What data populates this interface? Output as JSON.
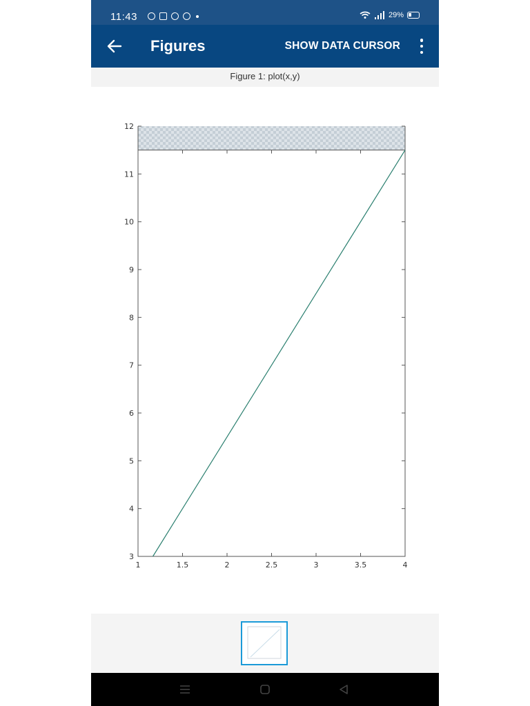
{
  "status_bar": {
    "time": "11:43",
    "battery_percent": "29%",
    "icons": [
      "messenger-icon",
      "calendar-icon",
      "message-icon",
      "facebook-icon",
      "wifi-icon",
      "signal-icon",
      "battery-icon"
    ]
  },
  "app_bar": {
    "title": "Figures",
    "data_cursor_label": "SHOW DATA CURSOR"
  },
  "figure": {
    "header": "Figure 1: plot(x,y)"
  },
  "colors": {
    "status_bar": "#1e5287",
    "app_bar": "#084781",
    "line": "#2a7f6f",
    "thumbnail_border": "#1a9ad8"
  },
  "chart_data": {
    "type": "line",
    "series": [
      {
        "x": [
          1.167,
          4.0
        ],
        "y": [
          3.0,
          11.5
        ]
      }
    ],
    "xlim": [
      1,
      4
    ],
    "ylim": [
      3,
      12
    ],
    "xticks": [
      "1",
      "1.5",
      "2",
      "2.5",
      "3",
      "3.5",
      "4"
    ],
    "yticks": [
      "3",
      "4",
      "5",
      "6",
      "7",
      "8",
      "9",
      "10",
      "11",
      "12"
    ],
    "grid": false,
    "legend": "none",
    "checkered_band": [
      11.5,
      12
    ]
  }
}
